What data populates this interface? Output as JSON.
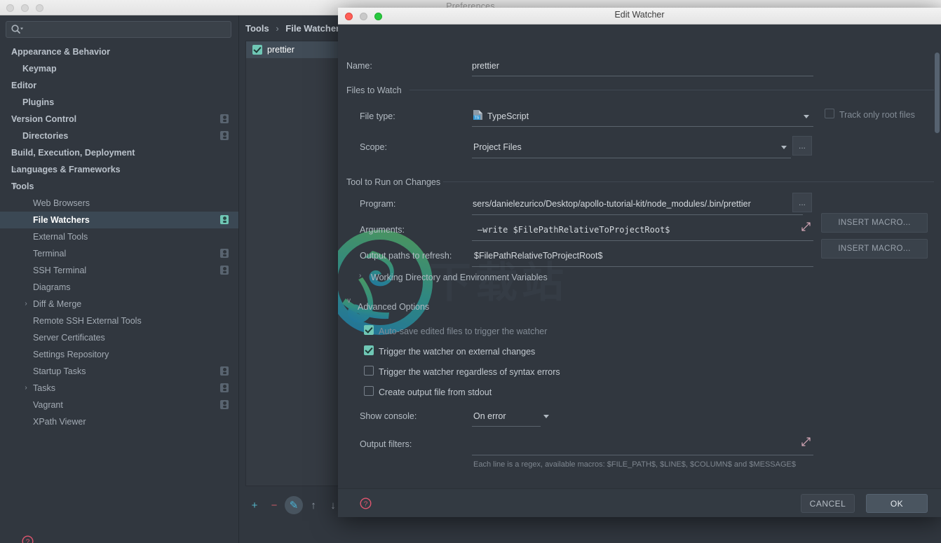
{
  "prefs_window": {
    "title": "Preferences",
    "traffic_lights": [
      "close",
      "minimize",
      "maximize"
    ],
    "help_icon": "question-mark-icon"
  },
  "search": {
    "value": "",
    "placeholder": "",
    "icon": "search-icon"
  },
  "sidebar": {
    "items": [
      {
        "label": "Appearance & Behavior",
        "indent": 16,
        "arrow": "›",
        "top": true,
        "badge": false,
        "selected": false
      },
      {
        "label": "Keymap",
        "indent": 32,
        "arrow": "",
        "top": true,
        "badge": false,
        "selected": false
      },
      {
        "label": "Editor",
        "indent": 16,
        "arrow": "›",
        "top": true,
        "badge": false,
        "selected": false
      },
      {
        "label": "Plugins",
        "indent": 32,
        "arrow": "",
        "top": true,
        "badge": false,
        "selected": false
      },
      {
        "label": "Version Control",
        "indent": 16,
        "arrow": "›",
        "top": true,
        "badge": true,
        "selected": false
      },
      {
        "label": "Directories",
        "indent": 32,
        "arrow": "",
        "top": true,
        "badge": true,
        "selected": false
      },
      {
        "label": "Build, Execution, Deployment",
        "indent": 16,
        "arrow": "›",
        "top": true,
        "badge": false,
        "selected": false
      },
      {
        "label": "Languages & Frameworks",
        "indent": 16,
        "arrow": "›",
        "top": true,
        "badge": false,
        "selected": false
      },
      {
        "label": "Tools",
        "indent": 16,
        "arrow": "∨",
        "top": true,
        "badge": false,
        "selected": false
      },
      {
        "label": "Web Browsers",
        "indent": 47,
        "arrow": "",
        "top": false,
        "badge": false,
        "selected": false
      },
      {
        "label": "File Watchers",
        "indent": 47,
        "arrow": "",
        "top": false,
        "badge": true,
        "selected": true
      },
      {
        "label": "External Tools",
        "indent": 47,
        "arrow": "",
        "top": false,
        "badge": false,
        "selected": false
      },
      {
        "label": "Terminal",
        "indent": 47,
        "arrow": "",
        "top": false,
        "badge": true,
        "selected": false
      },
      {
        "label": "SSH Terminal",
        "indent": 47,
        "arrow": "",
        "top": false,
        "badge": true,
        "selected": false
      },
      {
        "label": "Diagrams",
        "indent": 47,
        "arrow": "",
        "top": false,
        "badge": false,
        "selected": false
      },
      {
        "label": "Diff & Merge",
        "indent": 47,
        "arrow": "›",
        "top": false,
        "badge": false,
        "selected": false,
        "arrowIndent": 30
      },
      {
        "label": "Remote SSH External Tools",
        "indent": 47,
        "arrow": "",
        "top": false,
        "badge": false,
        "selected": false
      },
      {
        "label": "Server Certificates",
        "indent": 47,
        "arrow": "",
        "top": false,
        "badge": false,
        "selected": false
      },
      {
        "label": "Settings Repository",
        "indent": 47,
        "arrow": "",
        "top": false,
        "badge": false,
        "selected": false
      },
      {
        "label": "Startup Tasks",
        "indent": 47,
        "arrow": "",
        "top": false,
        "badge": true,
        "selected": false
      },
      {
        "label": "Tasks",
        "indent": 47,
        "arrow": "›",
        "top": false,
        "badge": true,
        "selected": false,
        "arrowIndent": 30
      },
      {
        "label": "Vagrant",
        "indent": 47,
        "arrow": "",
        "top": false,
        "badge": true,
        "selected": false
      },
      {
        "label": "XPath Viewer",
        "indent": 47,
        "arrow": "",
        "top": false,
        "badge": false,
        "selected": false
      }
    ]
  },
  "content": {
    "breadcrumb": {
      "parent": "Tools",
      "separator": "›",
      "current": "File Watchers"
    },
    "watchers": [
      {
        "name": "prettier",
        "checked": true,
        "selected": true
      }
    ],
    "toolbar": [
      {
        "name": "add",
        "glyph": "+",
        "active": false
      },
      {
        "name": "remove",
        "glyph": "−",
        "active": false
      },
      {
        "name": "edit",
        "glyph": "✎",
        "active": true
      },
      {
        "name": "move-up",
        "glyph": "↑",
        "active": false
      },
      {
        "name": "move-down",
        "glyph": "↓",
        "active": false
      }
    ]
  },
  "dialog": {
    "title": "Edit Watcher",
    "help_icon": "question-mark-icon",
    "name": {
      "label": "Name:",
      "value": "prettier"
    },
    "files_to_watch": {
      "section_label": "Files to Watch",
      "file_type": {
        "label": "File type:",
        "value": "TypeScript",
        "icon": "typescript-file-icon"
      },
      "scope": {
        "label": "Scope:",
        "value": "Project Files",
        "browse_label": "..."
      },
      "track_only_root_files": {
        "label": "Track only root files",
        "checked": false,
        "enabled": false
      }
    },
    "tool_to_run": {
      "section_label": "Tool to Run on Changes",
      "program": {
        "label": "Program:",
        "value": "sers/danielezurico/Desktop/apollo-tutorial-kit/node_modules/.bin/prettier",
        "browse_label": "..."
      },
      "arguments": {
        "label": "Arguments:",
        "value": "—write $FilePathRelativeToProjectRoot$",
        "macro_label": "INSERT MACRO...",
        "expand_icon": "expand-icon"
      },
      "output_paths": {
        "label": "Output paths to refresh:",
        "value": "$FilePathRelativeToProjectRoot$",
        "macro_label": "INSERT MACRO..."
      },
      "working_directory": {
        "label": "Working Directory and Environment Variables",
        "expanded": false,
        "arrow": "›"
      }
    },
    "advanced": {
      "section_label": "Advanced Options",
      "expanded": true,
      "arrow": "∨",
      "checkboxes": [
        {
          "label": "Auto-save edited files to trigger the watcher",
          "checked": true,
          "dimmed": true
        },
        {
          "label": "Trigger the watcher on external changes",
          "checked": true,
          "dimmed": false
        },
        {
          "label": "Trigger the watcher regardless of syntax errors",
          "checked": false,
          "dimmed": false
        },
        {
          "label": "Create output file from stdout",
          "checked": false,
          "dimmed": false
        }
      ],
      "show_console": {
        "label": "Show console:",
        "value": "On error"
      },
      "output_filters": {
        "label": "Output filters:",
        "value": "",
        "hint": "Each line is a regex, available macros: $FILE_PATH$, $LINE$, $COLUMN$ and $MESSAGE$",
        "expand_icon": "expand-icon"
      }
    },
    "buttons": {
      "cancel": "CANCEL",
      "ok": "OK"
    }
  },
  "colors": {
    "window_bg": "#31373f",
    "accent_check": "#6fc7b5",
    "selection": "#3b4854",
    "help_icon": "#e0566f",
    "titlebar": "#ececec"
  }
}
